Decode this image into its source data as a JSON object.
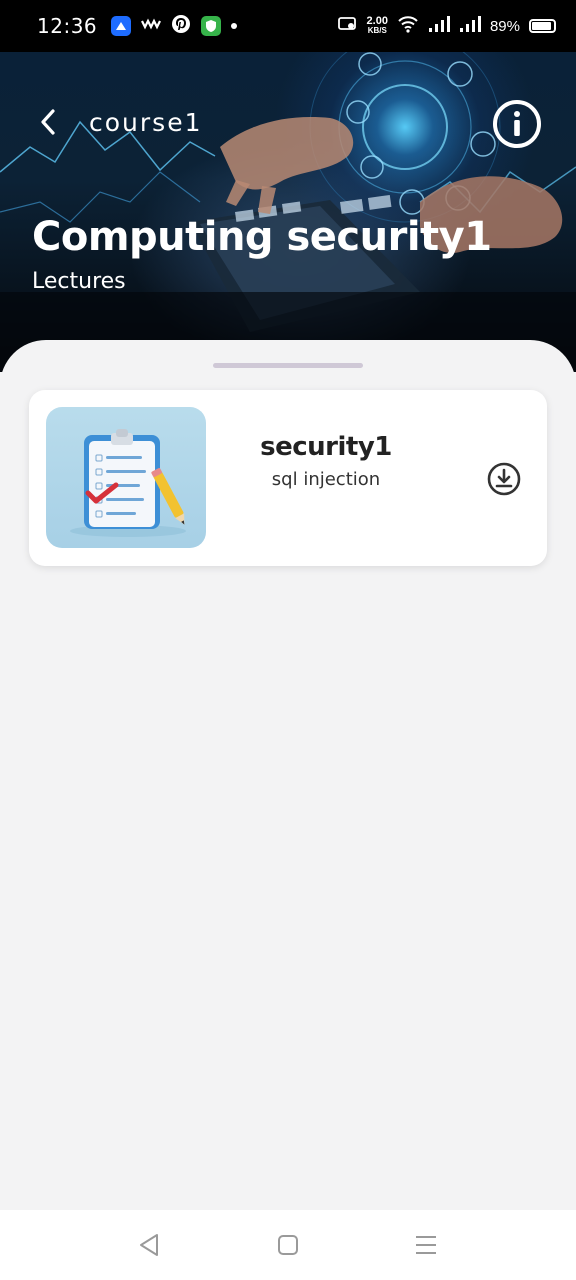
{
  "status_bar": {
    "time": "12:36",
    "net_speed_value": "2.00",
    "net_speed_unit": "KB/S",
    "battery_percent": "89%",
    "icons": [
      "app-store-icon",
      "wavy-app-icon",
      "pinterest-icon",
      "shield-app-icon",
      "notification-dot-icon",
      "cast-icon",
      "wifi-icon",
      "signal-icon",
      "signal-icon",
      "battery-icon"
    ]
  },
  "header": {
    "back_icon": "chevron-left-icon",
    "course_name": "course1",
    "info_icon": "info-icon",
    "title": "Computing security1",
    "subtitle": "Lectures"
  },
  "lectures": [
    {
      "title": "security1",
      "description": "sql injection",
      "thumbnail": "clipboard-checklist-icon",
      "action_icon": "download-icon"
    }
  ],
  "nav_bar": {
    "icons": [
      "back-triangle-icon",
      "home-square-icon",
      "menu-lines-icon"
    ]
  },
  "colors": {
    "sheet_background": "#f3f3f4",
    "card_background": "#ffffff",
    "handle": "#cfc8d6",
    "text_dark": "#222222"
  }
}
